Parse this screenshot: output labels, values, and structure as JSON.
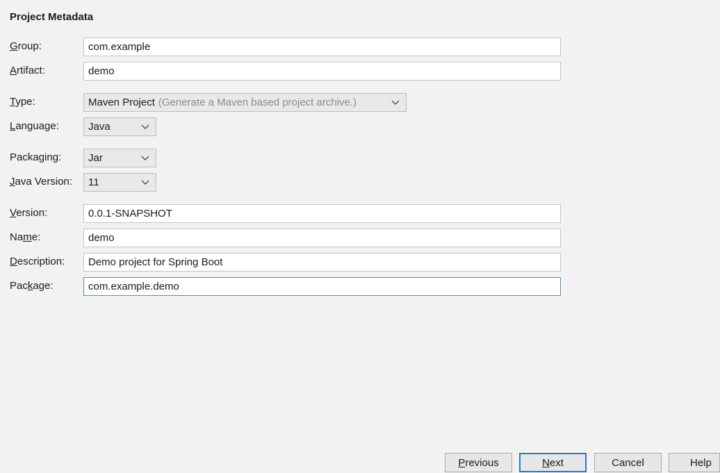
{
  "section_title": "Project Metadata",
  "fields": {
    "group": {
      "label_mnemonic": "G",
      "label_rest": "roup:",
      "value": "com.example"
    },
    "artifact": {
      "label_mnemonic": "A",
      "label_rest": "rtifact:",
      "value": "demo"
    },
    "type": {
      "label_mnemonic": "T",
      "label_rest": "ype:",
      "value": "Maven Project",
      "hint": "(Generate a Maven based project archive.)"
    },
    "language": {
      "label_mnemonic": "L",
      "label_rest": "anguage:",
      "value": "Java"
    },
    "packaging": {
      "label_pre": "Packa",
      "label_mnemonic": "g",
      "label_rest": "ing:",
      "value": "Jar"
    },
    "java_version": {
      "label_mnemonic": "J",
      "label_rest": "ava Version:",
      "value": "11"
    },
    "version": {
      "label_mnemonic": "V",
      "label_rest": "ersion:",
      "value": "0.0.1-SNAPSHOT"
    },
    "name": {
      "label_pre": "Na",
      "label_mnemonic": "m",
      "label_rest": "e:",
      "value": "demo"
    },
    "description": {
      "label_mnemonic": "D",
      "label_rest": "escription:",
      "value": "Demo project for Spring Boot"
    },
    "package": {
      "label_pre": "Pac",
      "label_mnemonic": "k",
      "label_rest": "age:",
      "value": "com.example.demo"
    }
  },
  "buttons": {
    "previous": {
      "mnemonic": "P",
      "rest": "revious"
    },
    "next": {
      "mnemonic": "N",
      "rest": "ext"
    },
    "cancel": {
      "label": "Cancel"
    },
    "help": {
      "label": "Help"
    }
  },
  "icons": {
    "dropdown": "chevron-down-icon"
  },
  "colors": {
    "focus_border": "#3c8fd6",
    "default_button_border": "#2a78c2"
  }
}
